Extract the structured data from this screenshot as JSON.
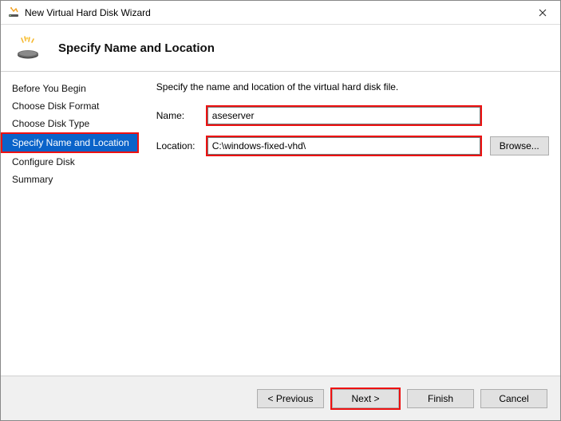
{
  "window": {
    "title": "New Virtual Hard Disk Wizard",
    "page_heading": "Specify Name and Location"
  },
  "sidebar": {
    "items": [
      {
        "label": "Before You Begin"
      },
      {
        "label": "Choose Disk Format"
      },
      {
        "label": "Choose Disk Type"
      },
      {
        "label": "Specify Name and Location"
      },
      {
        "label": "Configure Disk"
      },
      {
        "label": "Summary"
      }
    ],
    "active_index": 3
  },
  "content": {
    "instruction": "Specify the name and location of the virtual hard disk file.",
    "name_label": "Name:",
    "name_value": "aseserver",
    "location_label": "Location:",
    "location_value": "C:\\windows-fixed-vhd\\",
    "browse_label": "Browse..."
  },
  "footer": {
    "previous": "< Previous",
    "next": "Next >",
    "finish": "Finish",
    "cancel": "Cancel"
  },
  "highlights": {
    "sidebar_step": true,
    "name_field": true,
    "location_field": true,
    "next_button": true
  }
}
